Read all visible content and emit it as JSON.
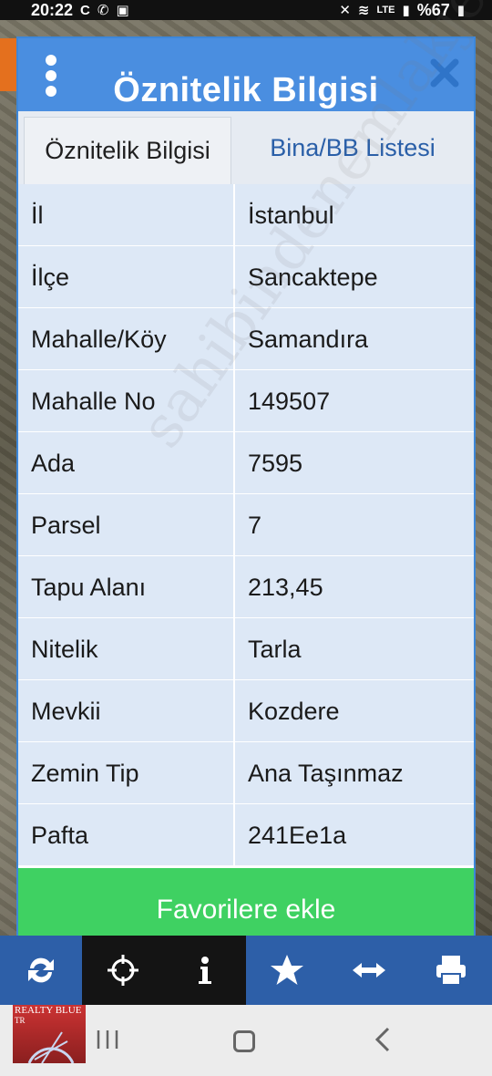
{
  "status": {
    "time": "20:22",
    "left_icons": [
      "c-icon",
      "whatsapp-icon",
      "gallery-icon"
    ],
    "network": "LTE",
    "battery": "%67"
  },
  "dialog": {
    "title": "Öznitelik Bilgisi",
    "tabs": [
      {
        "label": "Öznitelik Bilgisi",
        "active": true
      },
      {
        "label": "Bina/BB Listesi",
        "active": false
      }
    ],
    "rows": [
      {
        "key": "İl",
        "value": "İstanbul"
      },
      {
        "key": "İlçe",
        "value": "Sancaktepe"
      },
      {
        "key": "Mahalle/Köy",
        "value": "Samandıra"
      },
      {
        "key": "Mahalle No",
        "value": "149507"
      },
      {
        "key": "Ada",
        "value": "7595"
      },
      {
        "key": "Parsel",
        "value": "7"
      },
      {
        "key": "Tapu Alanı",
        "value": "213,45"
      },
      {
        "key": "Nitelik",
        "value": "Tarla"
      },
      {
        "key": "Mevkii",
        "value": "Kozdere"
      },
      {
        "key": "Zemin Tip",
        "value": "Ana Taşınmaz"
      },
      {
        "key": "Pafta",
        "value": "241Ee1a"
      }
    ],
    "favorite_button": "Favorilere ekle"
  },
  "watermark": "sahibindenemlakjet.com",
  "logo_text": "REALTY BLUE",
  "logo_sub": "TR",
  "colors": {
    "header": "#4a8ee0",
    "row_bg": "#dde8f6",
    "button": "#3fd162",
    "toolbar": "#2d5fa8"
  },
  "toolbar_icons": [
    "refresh-icon",
    "crosshair-icon",
    "info-icon",
    "star-icon",
    "measure-icon",
    "print-icon"
  ]
}
